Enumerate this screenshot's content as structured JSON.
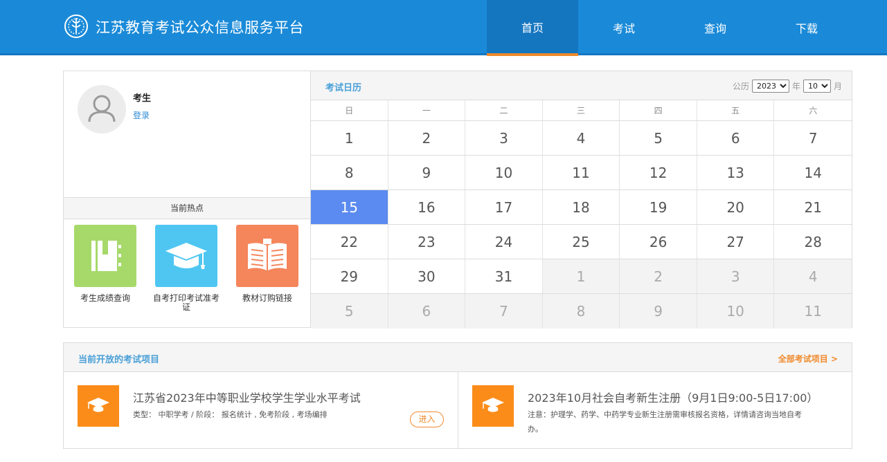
{
  "header": {
    "site_title": "江苏教育考试公众信息服务平台",
    "logo_icon": "emblem-icon",
    "nav": [
      {
        "label": "首页",
        "active": true
      },
      {
        "label": "考试",
        "active": false
      },
      {
        "label": "查询",
        "active": false
      },
      {
        "label": "下载",
        "active": false
      }
    ],
    "colors": {
      "bar": "#1a8ad8",
      "active": "#1576c0",
      "accent": "#f08a2c"
    }
  },
  "user": {
    "name": "考生",
    "login_label": "登录",
    "avatar_icon": "user-icon"
  },
  "hot": {
    "title": "当前热点",
    "items": [
      {
        "label": "考生成绩查询",
        "icon": "notebook-icon",
        "color": "#a6d96a"
      },
      {
        "label": "自考打印考试准考证",
        "icon": "graduation-cap-icon",
        "color": "#4ec6f1"
      },
      {
        "label": "教材订购链接",
        "icon": "open-book-icon",
        "color": "#f5855b"
      }
    ]
  },
  "calendar": {
    "title": "考试日历",
    "calendar_label": "公历",
    "year": "2023",
    "year_unit": "年",
    "month": "10",
    "month_unit": "月",
    "weekdays": [
      "日",
      "一",
      "二",
      "三",
      "四",
      "五",
      "六"
    ],
    "weeks": [
      [
        {
          "d": "1"
        },
        {
          "d": "2"
        },
        {
          "d": "3"
        },
        {
          "d": "4"
        },
        {
          "d": "5"
        },
        {
          "d": "6"
        },
        {
          "d": "7"
        }
      ],
      [
        {
          "d": "8"
        },
        {
          "d": "9"
        },
        {
          "d": "10"
        },
        {
          "d": "11"
        },
        {
          "d": "12"
        },
        {
          "d": "13"
        },
        {
          "d": "14"
        }
      ],
      [
        {
          "d": "15",
          "today": true
        },
        {
          "d": "16"
        },
        {
          "d": "17"
        },
        {
          "d": "18"
        },
        {
          "d": "19"
        },
        {
          "d": "20"
        },
        {
          "d": "21"
        }
      ],
      [
        {
          "d": "22"
        },
        {
          "d": "23"
        },
        {
          "d": "24"
        },
        {
          "d": "25"
        },
        {
          "d": "26"
        },
        {
          "d": "27"
        },
        {
          "d": "28"
        }
      ],
      [
        {
          "d": "29"
        },
        {
          "d": "30"
        },
        {
          "d": "31"
        },
        {
          "d": "1",
          "other": true
        },
        {
          "d": "2",
          "other": true
        },
        {
          "d": "3",
          "other": true
        },
        {
          "d": "4",
          "other": true
        }
      ],
      [
        {
          "d": "5",
          "other": true
        },
        {
          "d": "6",
          "other": true
        },
        {
          "d": "7",
          "other": true
        },
        {
          "d": "8",
          "other": true
        },
        {
          "d": "9",
          "other": true
        },
        {
          "d": "10",
          "other": true
        },
        {
          "d": "11",
          "other": true
        }
      ]
    ],
    "today_color": "#5b8bf0"
  },
  "projects": {
    "title": "当前开放的考试项目",
    "all_link": "全部考试项目 >",
    "items": [
      {
        "name": "江苏省2023年中等职业学校学生学业水平考试",
        "meta": "类型：  中职学考 / 阶段：  报名统计 , 免考阶段 , 考场编排",
        "button": "进入",
        "icon": "graduation-cap-icon"
      },
      {
        "name": "2023年10月社会自考新生注册（9月1日9:00-5日17:00）",
        "meta": "注意：护理学、药学、中药学专业新生注册需审核报名资格，详情请咨询当地自考办。",
        "icon": "graduation-cap-icon"
      }
    ],
    "icon_color": "#fb8c1a"
  }
}
